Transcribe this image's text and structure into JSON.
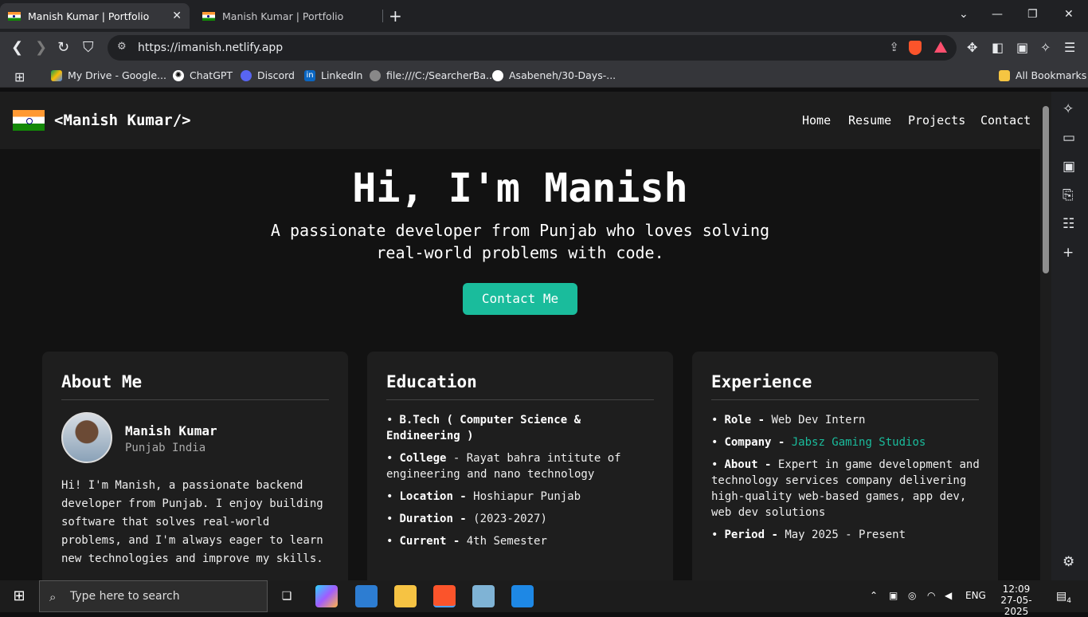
{
  "browser": {
    "tabs": [
      {
        "title": "Manish Kumar | Portfolio"
      },
      {
        "title": "Manish Kumar | Portfolio"
      }
    ],
    "url": "https://imanish.netlify.app",
    "bookmarks": [
      "My Drive - Google...",
      "ChatGPT",
      "Discord",
      "LinkedIn",
      "file:///C:/SearcherBa...",
      "Asabeneh/30-Days-...",
      "All Bookmarks"
    ]
  },
  "site": {
    "logo": "<Manish Kumar/>",
    "nav": [
      "Home",
      "Resume",
      "Projects",
      "Contact"
    ],
    "hero": {
      "title": "Hi, I'm Manish",
      "subtitle": "A passionate developer from Punjab who loves solving real-world problems with code.",
      "cta": "Contact Me"
    },
    "about": {
      "heading": "About Me",
      "name": "Manish Kumar",
      "location": "Punjab India",
      "bio": "Hi! I'm Manish, a passionate backend developer from Punjab. I enjoy building software that solves real-world problems, and I'm always eager to learn new technologies and improve my skills."
    },
    "education": {
      "heading": "Education",
      "items": [
        {
          "label": "B.Tech ( Computer Science & Endineering )",
          "value": ""
        },
        {
          "label": "College",
          "value": "- Rayat bahra intitute of engineering and nano technology"
        },
        {
          "label": "Location -",
          "value": "Hoshiapur Punjab"
        },
        {
          "label": "Duration -",
          "value": "(2023-2027)"
        },
        {
          "label": "Current -",
          "value": "4th Semester"
        }
      ]
    },
    "experience": {
      "heading": "Experience",
      "items": [
        {
          "label": "Role -",
          "value": "Web Dev Intern"
        },
        {
          "label": "Company -",
          "value": "Jabsz Gaming Studios"
        },
        {
          "label": "About -",
          "value": "Expert in game development and technology services company delivering high-quality web-based games, app dev, web dev solutions"
        },
        {
          "label": "Period -",
          "value": "May 2025 - Present"
        }
      ]
    }
  },
  "taskbar": {
    "search_placeholder": "Type here to search",
    "lang": "ENG",
    "time": "12:09",
    "date": "27-05-2025",
    "notifications": "4"
  }
}
